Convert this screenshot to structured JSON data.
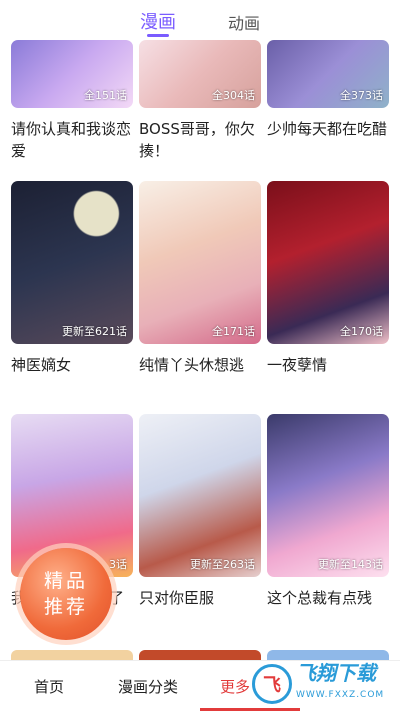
{
  "top_tabs": [
    {
      "label": "漫画",
      "active": true
    },
    {
      "label": "动画",
      "active": false
    }
  ],
  "comics": [
    {
      "title": "请你认真和我谈恋爱",
      "badge": "全151话"
    },
    {
      "title": "BOSS哥哥，你欠揍！",
      "badge": "全304话"
    },
    {
      "title": "少帅每天都在吃醋",
      "badge": "全373话"
    },
    {
      "title": "神医嫡女",
      "badge": "更新至621话"
    },
    {
      "title": "纯情丫头休想逃",
      "badge": "全171话"
    },
    {
      "title": "一夜孽情",
      "badge": "全170话"
    },
    {
      "title": "我",
      "badge": "3话"
    },
    {
      "title": "只对你臣服",
      "badge": "更新至263话"
    },
    {
      "title": "这个总裁有点残",
      "badge": "更新至143话"
    }
  ],
  "hidden_title_fragment": "了",
  "recommend": {
    "line1": "精品",
    "line2": "推荐"
  },
  "bottom_nav": [
    {
      "label": "首页",
      "active": false
    },
    {
      "label": "漫画分类",
      "active": false
    },
    {
      "label": "更多",
      "active": true
    }
  ],
  "watermark": {
    "logo": "飞",
    "text": "飞翔下载",
    "sub": "WWW.FXXZ.COM"
  },
  "colors": {
    "accent_purple": "#7a5cff",
    "accent_red": "#e23b3b"
  }
}
